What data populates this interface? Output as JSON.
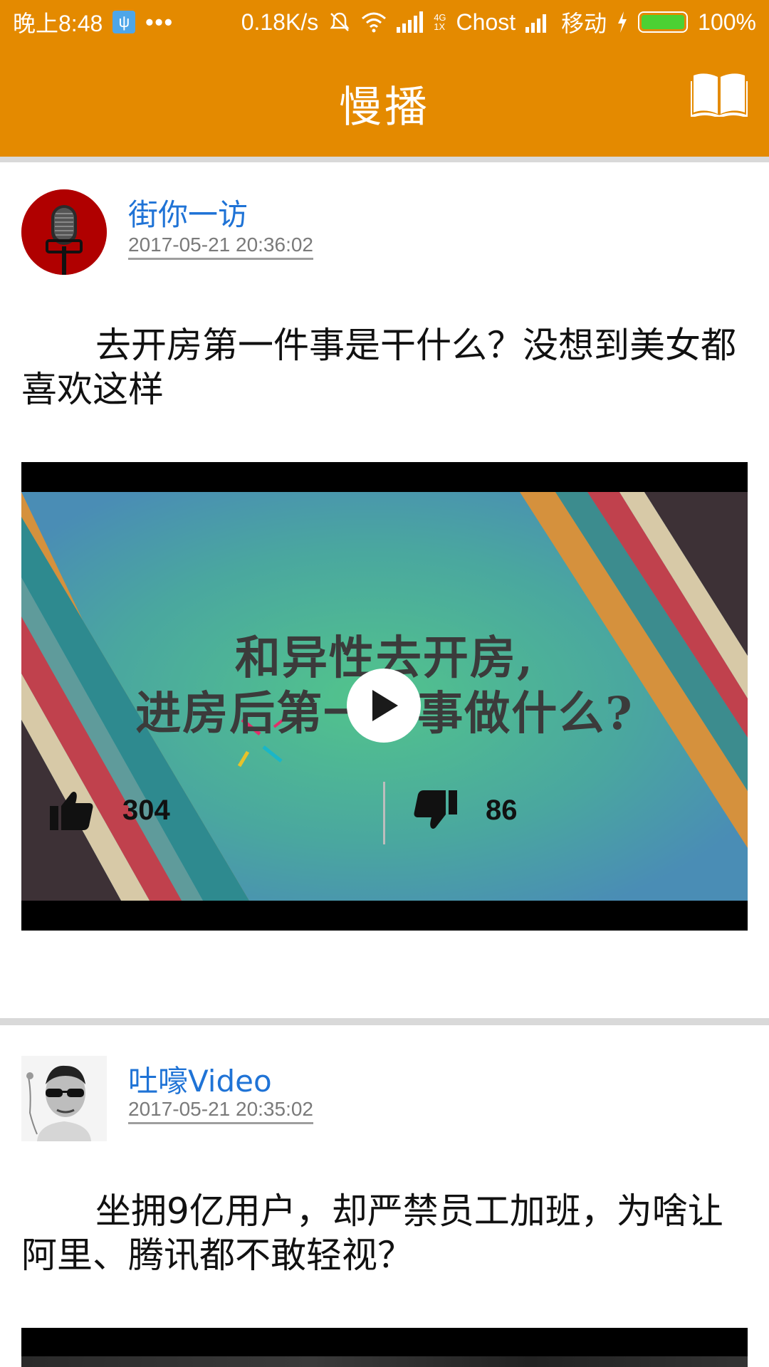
{
  "status_bar": {
    "time": "晚上8:48",
    "usb_icon": "usb-icon",
    "more": "•••",
    "net_speed": "0.18K/s",
    "net_type_top": "4G",
    "net_type_bottom": "1X",
    "carrier1": "Chost",
    "carrier2": "移动",
    "battery": "100%",
    "battery_level": 1.0
  },
  "header": {
    "title": "慢播",
    "bookmark_icon": "book-icon"
  },
  "feed": [
    {
      "author": "街你一访",
      "time": "2017-05-21 20:36:02",
      "headline": "去开房第一件事是干什么？没想到美女都喜欢这样",
      "video_overlay_line1": "和异性去开房,",
      "video_overlay_line2": "进房后第一件事做什么?",
      "likes": "304",
      "dislikes": "86"
    },
    {
      "author": "吐嚎Video",
      "time": "2017-05-21 20:35:02",
      "headline": "坐拥9亿用户，却严禁员工加班，为啥让阿里、腾讯都不敢轻视？"
    }
  ],
  "colors": {
    "accent": "#e48a00",
    "author_link": "#1f73d6",
    "divider": "#d9d9d9"
  }
}
